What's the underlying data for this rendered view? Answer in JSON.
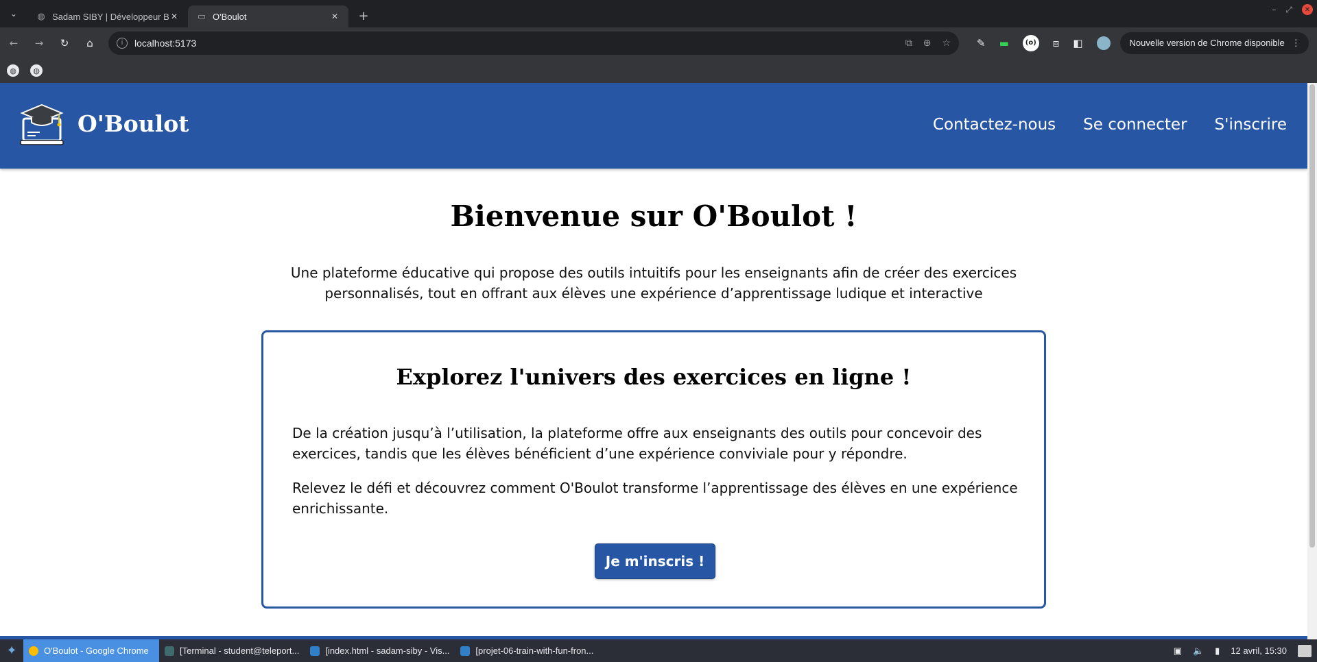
{
  "browser": {
    "tabs": [
      {
        "title": "Sadam SIBY | Développeur B",
        "active": false
      },
      {
        "title": "O'Boulot",
        "active": true
      }
    ],
    "url": "localhost:5173",
    "update_label": "Nouvelle version de Chrome disponible"
  },
  "site": {
    "brand": "O'Boulot",
    "nav": {
      "contact": "Contactez-nous",
      "login": "Se connecter",
      "signup": "S'inscrire"
    },
    "hero": {
      "title": "Bienvenue sur O'Boulot !",
      "text": "Une plateforme éducative qui propose des outils intuitifs pour les enseignants afin de créer des exercices personnalisés, tout en offrant aux élèves une expérience d’apprentissage ludique et interactive"
    },
    "card": {
      "title": "Explorez l'univers des exercices en ligne !",
      "p1": "De la création jusqu’à l’utilisation, la plateforme offre aux enseignants des outils pour concevoir des exercices, tandis que les élèves bénéficient d’une expérience conviviale pour y répondre.",
      "p2": "Relevez le défi et découvrez comment O'Boulot transforme l’apprentissage des élèves en une expérience enrichissante.",
      "cta": "Je m'inscris !"
    },
    "colors": {
      "primary": "#2756a4"
    }
  },
  "taskbar": {
    "items": [
      {
        "label": "O'Boulot - Google Chrome",
        "active": true
      },
      {
        "label": "[Terminal - student@teleport...",
        "active": false
      },
      {
        "label": "[index.html - sadam-siby - Vis...",
        "active": false
      },
      {
        "label": "[projet-06-train-with-fun-fron...",
        "active": false
      }
    ],
    "clock": "12 avril, 15:30"
  }
}
